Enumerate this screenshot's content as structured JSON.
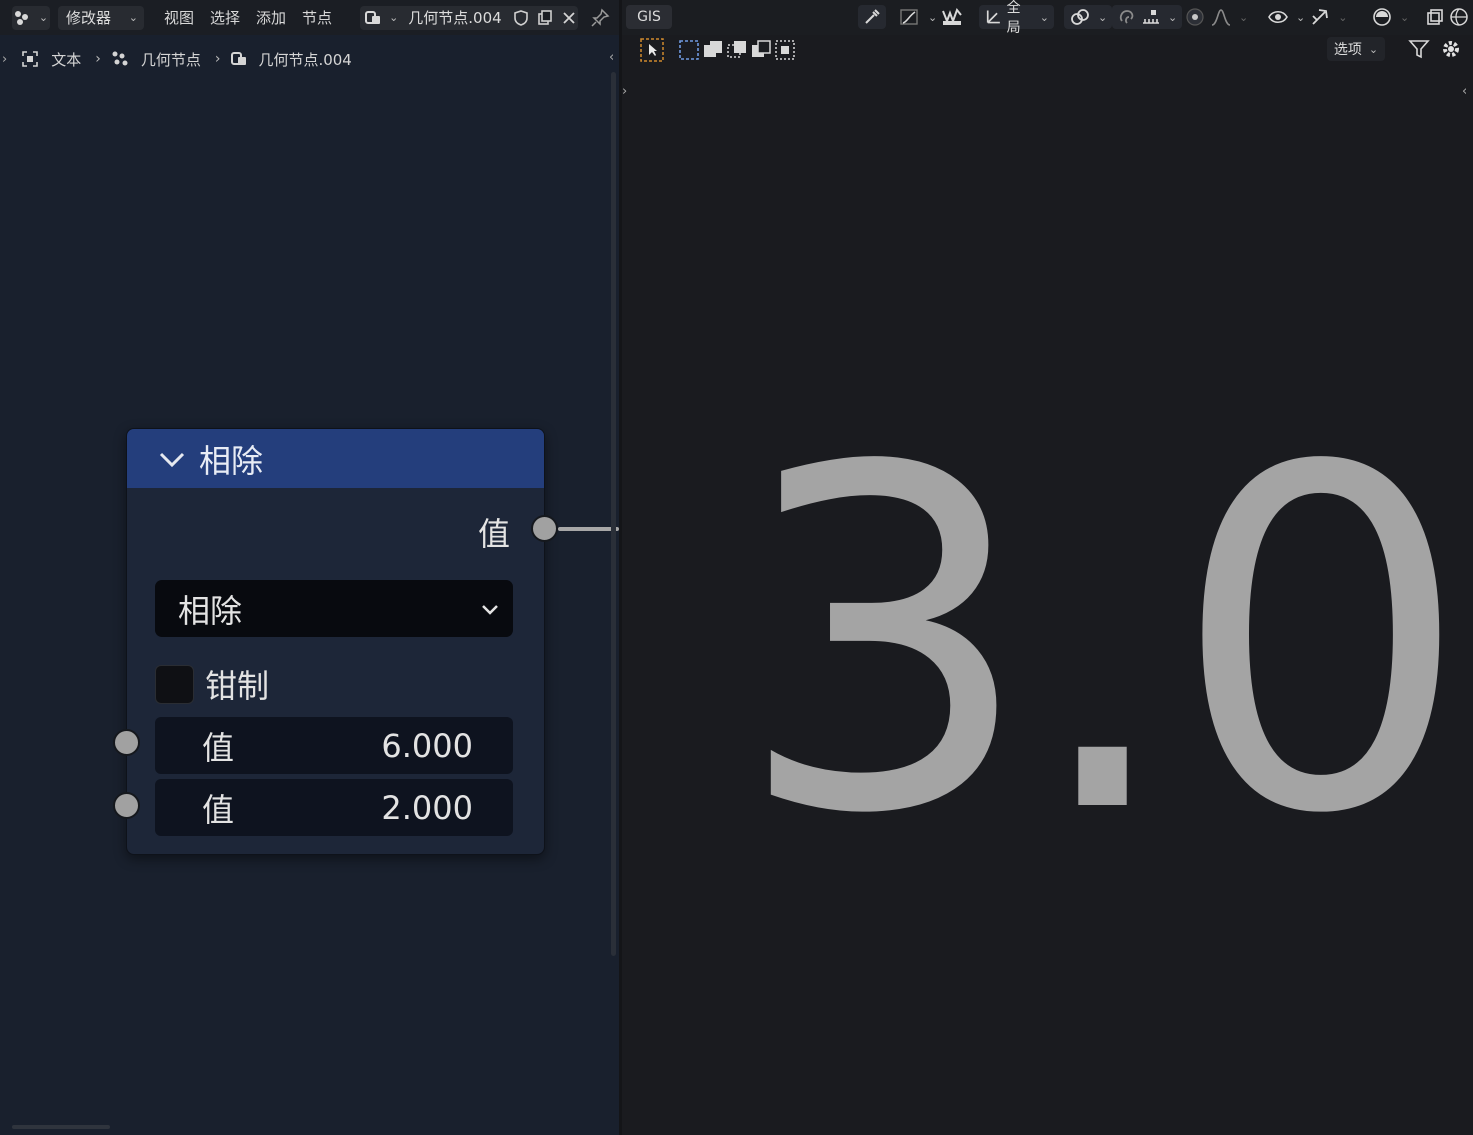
{
  "node_editor": {
    "header": {
      "editor_type_icon": "node-editor-icon",
      "mode_label": "修改器",
      "menus": [
        "视图",
        "选择",
        "添加",
        "节点"
      ],
      "datablock_name": "几何节点.004"
    },
    "breadcrumb": {
      "items": [
        "文本",
        "几何节点",
        "几何节点.004"
      ]
    },
    "node": {
      "title": "相除",
      "output_label": "值",
      "operation": "相除",
      "clamp_label": "钳制",
      "clamp_checked": false,
      "inputs": [
        {
          "label": "值",
          "value": "6.000"
        },
        {
          "label": "值",
          "value": "2.000"
        }
      ],
      "header_color": "#243e7c"
    }
  },
  "viewport": {
    "header": {
      "gis_label": "GIS",
      "transform_orientation": "全局",
      "options_label": "选项"
    },
    "result_text": "3.0",
    "text_color": "#a4a4a4"
  }
}
